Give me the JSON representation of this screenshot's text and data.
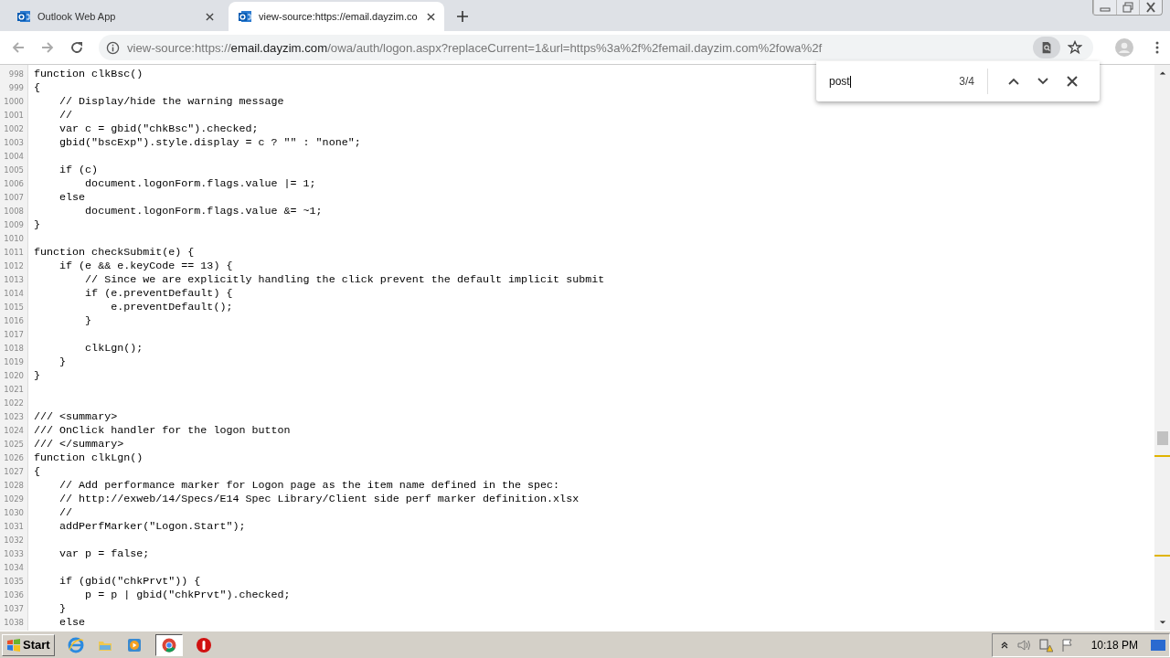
{
  "tabs": [
    {
      "title": "Outlook Web App",
      "selected": false
    },
    {
      "title": "view-source:https://email.dayzim.co",
      "selected": true
    }
  ],
  "address": {
    "scheme": "view-source:https://",
    "host": "email.dayzim.com",
    "path": "/owa/auth/logon.aspx?replaceCurrent=1&url=https%3a%2f%2femail.dayzim.com%2fowa%2f"
  },
  "find_bar": {
    "query": "post",
    "count": "3/4"
  },
  "source_lines": [
    {
      "number": "998",
      "code": "function clkBsc()"
    },
    {
      "number": "999",
      "code": "{"
    },
    {
      "number": "1000",
      "code": "    // Display/hide the warning message"
    },
    {
      "number": "1001",
      "code": "    //"
    },
    {
      "number": "1002",
      "code": "    var c = gbid(\"chkBsc\").checked;"
    },
    {
      "number": "1003",
      "code": "    gbid(\"bscExp\").style.display = c ? \"\" : \"none\";"
    },
    {
      "number": "1004"
    },
    {
      "number": "1005",
      "code": "    if (c)"
    },
    {
      "number": "1006",
      "code": "        document.logonForm.flags.value |= 1;"
    },
    {
      "number": "1007",
      "code": "    else"
    },
    {
      "number": "1008",
      "code": "        document.logonForm.flags.value &= ~1;"
    },
    {
      "number": "1009",
      "code": "}"
    },
    {
      "number": "1010"
    },
    {
      "number": "1011",
      "code": "function checkSubmit(e) {"
    },
    {
      "number": "1012",
      "code": "    if (e && e.keyCode == 13) {"
    },
    {
      "number": "1013",
      "code": "        // Since we are explicitly handling the click prevent the default implicit submit"
    },
    {
      "number": "1014",
      "code": "        if (e.preventDefault) {"
    },
    {
      "number": "1015",
      "code": "            e.preventDefault();"
    },
    {
      "number": "1016",
      "code": "        }"
    },
    {
      "number": "1017"
    },
    {
      "number": "1018",
      "code": "        clkLgn();"
    },
    {
      "number": "1019",
      "code": "    }"
    },
    {
      "number": "1020",
      "code": "}"
    },
    {
      "number": "1021"
    },
    {
      "number": "1022"
    },
    {
      "number": "1023",
      "code": "/// <summary>"
    },
    {
      "number": "1024",
      "code": "/// OnClick handler for the logon button"
    },
    {
      "number": "1025",
      "code": "/// </summary>"
    },
    {
      "number": "1026",
      "code": "function clkLgn()"
    },
    {
      "number": "1027",
      "code": "{"
    },
    {
      "number": "1028",
      "code": "    // Add performance marker for Logon page as the item name defined in the spec:"
    },
    {
      "number": "1029",
      "code": "    // http://exweb/14/Specs/E14 Spec Library/Client side perf marker definition.xlsx"
    },
    {
      "number": "1030",
      "code": "    //"
    },
    {
      "number": "1031",
      "code": "    addPerfMarker(\"Logon.Start\");"
    },
    {
      "number": "1032"
    },
    {
      "number": "1033",
      "code": "    var p = false;"
    },
    {
      "number": "1034"
    },
    {
      "number": "1035",
      "code": "    if (gbid(\"chkPrvt\")) {"
    },
    {
      "number": "1036",
      "code": "        p = p | gbid(\"chkPrvt\").checked;"
    },
    {
      "number": "1037",
      "code": "    }"
    },
    {
      "number": "1038",
      "code": "    else"
    }
  ],
  "taskbar": {
    "start": "Start",
    "clock": "10:18 PM"
  }
}
